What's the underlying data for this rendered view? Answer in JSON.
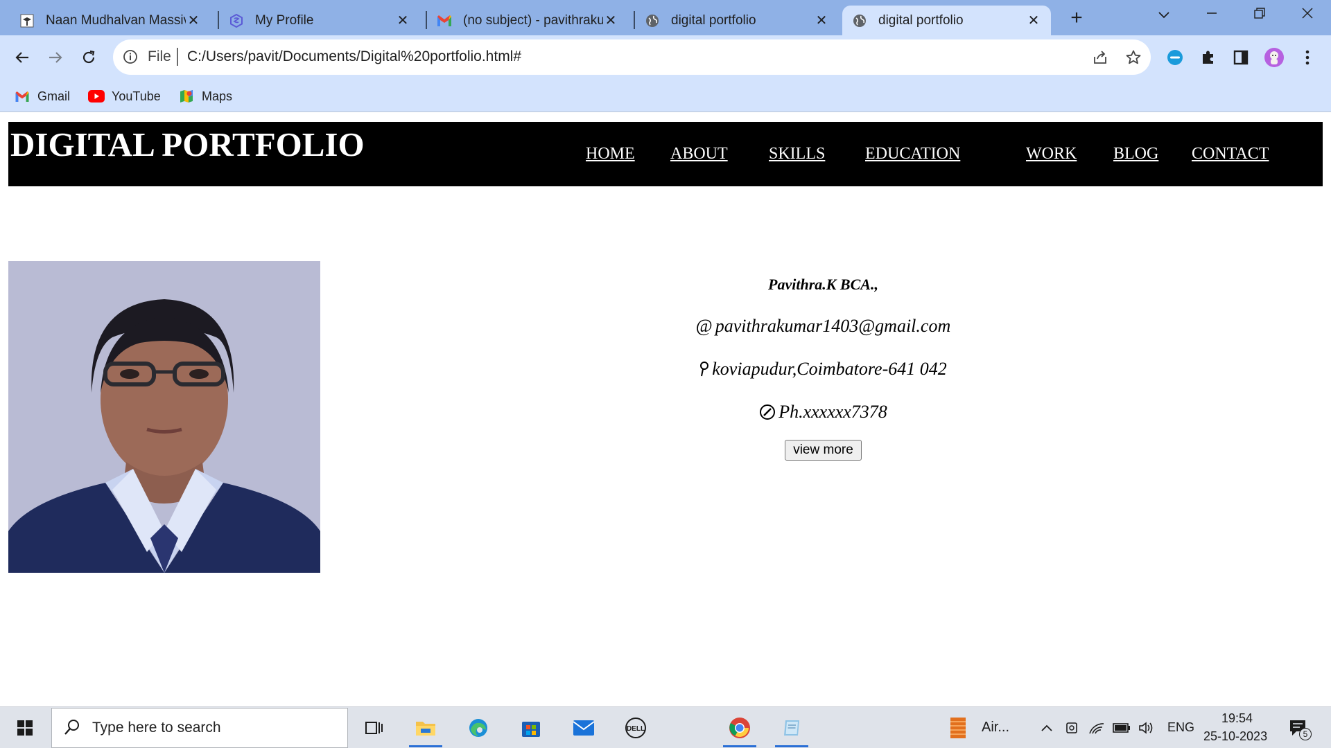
{
  "browser": {
    "tabs": [
      {
        "title": "Naan Mudhalvan Massive",
        "icon": "graduation-cap-icon",
        "active": false
      },
      {
        "title": "My Profile",
        "icon": "profile-site-icon",
        "active": false
      },
      {
        "title": "(no subject) - pavithrakum",
        "icon": "gmail-icon",
        "active": false
      },
      {
        "title": "digital portfolio",
        "icon": "globe-icon",
        "active": false
      },
      {
        "title": "digital portfolio",
        "icon": "globe-icon",
        "active": true
      }
    ],
    "omnibox": {
      "scheme_label": "File",
      "url": "C:/Users/pavit/Documents/Digital%20portfolio.html#"
    },
    "bookmarks": [
      {
        "label": "Gmail",
        "icon": "gmail-icon"
      },
      {
        "label": "YouTube",
        "icon": "youtube-icon"
      },
      {
        "label": "Maps",
        "icon": "maps-icon"
      }
    ]
  },
  "page": {
    "site_title": "DIGITAL PORTFOLIO",
    "nav": [
      "HOME",
      "ABOUT",
      "SKILLS",
      "EDUCATION",
      "WORK",
      "BLOG",
      "CONTACT"
    ],
    "profile": {
      "name": "Pavithra.K BCA.,",
      "email_icon": "@",
      "email": "pavithrakumar1403@gmail.com",
      "location": "koviapudur,Coimbatore-641 042",
      "phone": "Ph.xxxxxx7378",
      "button_label": "view more"
    }
  },
  "taskbar": {
    "search_placeholder": "Type here to search",
    "running_app_label": "Air...",
    "language": "ENG",
    "time": "19:54",
    "date": "25-10-2023",
    "notification_count": "5"
  },
  "colors": {
    "tabstrip": "#8fb1e6",
    "toolbar": "#d3e3fd",
    "site_header": "#000000",
    "taskbar": "#dfe3ea"
  }
}
